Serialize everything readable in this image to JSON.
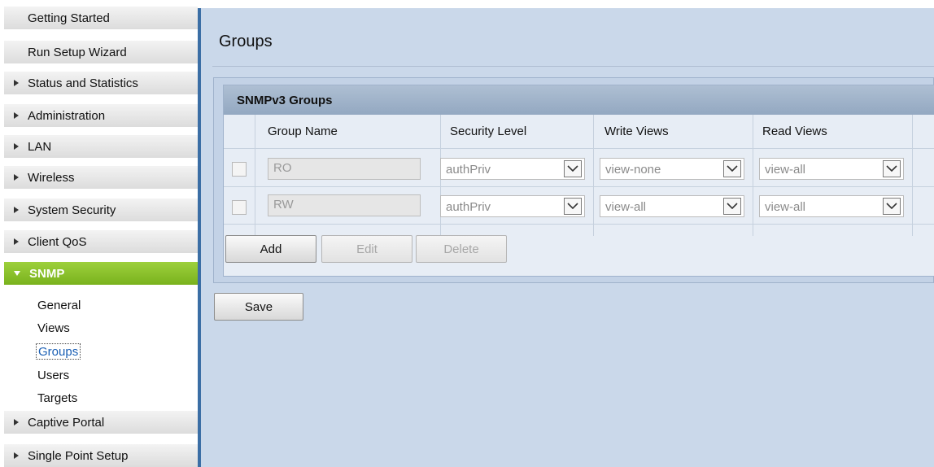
{
  "sidebar": {
    "items": [
      {
        "label": "Getting Started"
      },
      {
        "label": "Run Setup Wizard"
      },
      {
        "label": "Status and Statistics"
      },
      {
        "label": "Administration"
      },
      {
        "label": "LAN"
      },
      {
        "label": "Wireless"
      },
      {
        "label": "System Security"
      },
      {
        "label": "Client QoS"
      },
      {
        "label": "SNMP"
      },
      {
        "label": "Captive Portal"
      },
      {
        "label": "Single Point Setup"
      }
    ],
    "snmp_subitems": [
      {
        "label": "General"
      },
      {
        "label": "Views"
      },
      {
        "label": "Groups"
      },
      {
        "label": "Users"
      },
      {
        "label": "Targets"
      }
    ],
    "active_item": "SNMP",
    "current_subitem": "Groups"
  },
  "main": {
    "title": "Groups",
    "panel": {
      "title": "SNMPv3 Groups",
      "columns": [
        "Group Name",
        "Security Level",
        "Write Views",
        "Read Views"
      ],
      "rows": [
        {
          "checked": false,
          "group_name": "RO",
          "security_level": "authPriv",
          "write_views": "view-none",
          "read_views": "view-all"
        },
        {
          "checked": false,
          "group_name": "RW",
          "security_level": "authPriv",
          "write_views": "view-all",
          "read_views": "view-all"
        }
      ],
      "buttons": {
        "add": "Add",
        "edit": "Edit",
        "delete": "Delete"
      }
    },
    "save_label": "Save"
  },
  "colors": {
    "active_nav": "#8cc42d",
    "content_bg": "#cad8ea",
    "splitter": "#3b6ea5",
    "link": "#1a5fb4"
  }
}
